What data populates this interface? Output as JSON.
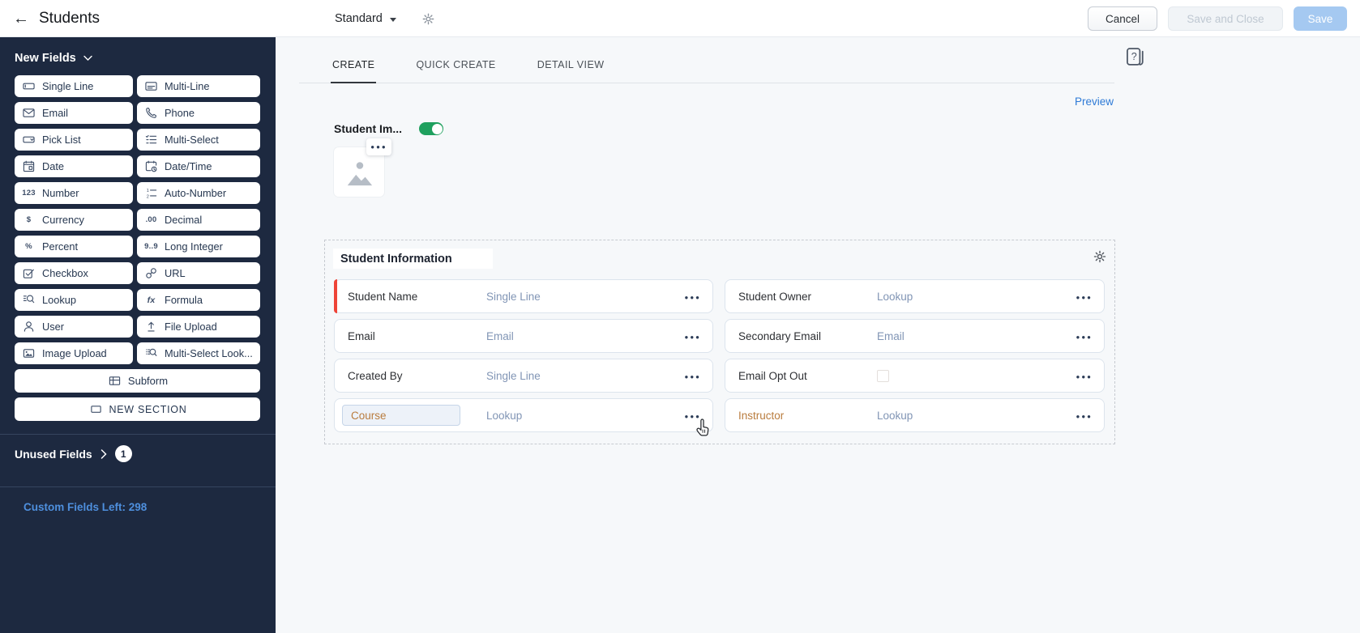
{
  "header": {
    "title": "Students",
    "back_icon": "arrow-left-icon",
    "layout_selector": {
      "label": "Standard",
      "caret_icon": "caret-down-icon",
      "settings_icon": "gear-icon"
    },
    "buttons": {
      "cancel": "Cancel",
      "save_and_close": "Save and Close",
      "save": "Save"
    }
  },
  "sidebar": {
    "new_fields_label": "New Fields",
    "field_buttons": [
      {
        "label": "Single Line",
        "icon": "single-line-icon"
      },
      {
        "label": "Multi-Line",
        "icon": "multi-line-icon"
      },
      {
        "label": "Email",
        "icon": "email-icon"
      },
      {
        "label": "Phone",
        "icon": "phone-icon"
      },
      {
        "label": "Pick List",
        "icon": "pick-list-icon"
      },
      {
        "label": "Multi-Select",
        "icon": "multi-select-icon"
      },
      {
        "label": "Date",
        "icon": "date-icon"
      },
      {
        "label": "Date/Time",
        "icon": "date-time-icon"
      },
      {
        "label": "Number",
        "icon": "number-icon"
      },
      {
        "label": "Auto-Number",
        "icon": "auto-number-icon"
      },
      {
        "label": "Currency",
        "icon": "currency-icon"
      },
      {
        "label": "Decimal",
        "icon": "decimal-icon"
      },
      {
        "label": "Percent",
        "icon": "percent-icon"
      },
      {
        "label": "Long Integer",
        "icon": "long-integer-icon"
      },
      {
        "label": "Checkbox",
        "icon": "checkbox-icon"
      },
      {
        "label": "URL",
        "icon": "url-icon"
      },
      {
        "label": "Lookup",
        "icon": "lookup-icon"
      },
      {
        "label": "Formula",
        "icon": "formula-icon"
      },
      {
        "label": "User",
        "icon": "user-icon"
      },
      {
        "label": "File Upload",
        "icon": "file-upload-icon"
      },
      {
        "label": "Image Upload",
        "icon": "image-upload-icon"
      },
      {
        "label": "Multi-Select Look...",
        "icon": "multi-select-lookup-icon"
      }
    ],
    "wide_buttons": [
      {
        "label": "Subform",
        "icon": "subform-icon",
        "caps": false
      },
      {
        "label": "NEW SECTION",
        "icon": "new-section-icon",
        "caps": true
      }
    ],
    "unused_fields": {
      "label": "Unused Fields",
      "count": "1",
      "chevron_icon": "chevron-right-icon"
    },
    "custom_fields_left": "Custom Fields Left: 298"
  },
  "main": {
    "tabs": [
      {
        "label": "CREATE",
        "active": true
      },
      {
        "label": "QUICK CREATE",
        "active": false
      },
      {
        "label": "DETAIL VIEW",
        "active": false
      }
    ],
    "preview_label": "Preview",
    "help_icon": "help-doc-icon"
  },
  "image_field": {
    "label": "Student Im...",
    "toggle_on": true,
    "placeholder_icon": "image-placeholder-icon",
    "menu_icon": "ellipsis-icon"
  },
  "section": {
    "title": "Student Information",
    "settings_icon": "gear-icon",
    "fields": [
      {
        "label": "Student Name",
        "type": "Single Line",
        "required": true
      },
      {
        "label": "Student Owner",
        "type": "Lookup"
      },
      {
        "label": "Email",
        "type": "Email"
      },
      {
        "label": "Secondary Email",
        "type": "Email"
      },
      {
        "label": "Created By",
        "type": "Single Line"
      },
      {
        "label": "Email Opt Out",
        "type": "",
        "control": "checkbox"
      },
      {
        "label": "Course",
        "type": "Lookup",
        "editing": true,
        "accent": "new"
      },
      {
        "label": "Instructor",
        "type": "Lookup",
        "accent": "new"
      }
    ]
  },
  "colors": {
    "sidebar_navy": "#1D2940",
    "toggle_green": "#1FA05E",
    "required_red": "#EE4438",
    "link_blue": "#2E7AD6",
    "custom_fields_blue": "#4E8FDD",
    "save_button_blue": "#A5C9F1",
    "new_field_orange": "#B97C3E"
  }
}
